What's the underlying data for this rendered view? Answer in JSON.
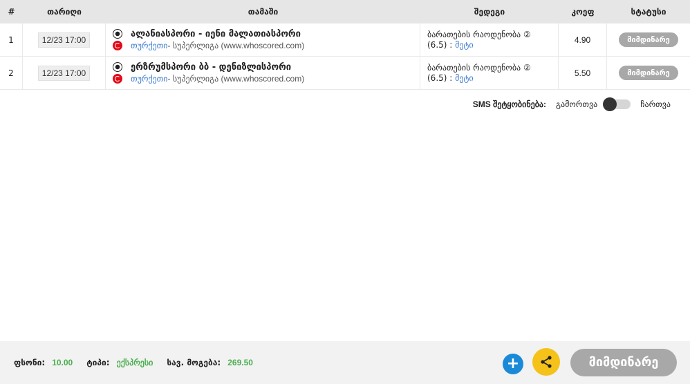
{
  "columns": {
    "idx": "#",
    "date": "თარიღი",
    "game": "თამაში",
    "bet": "შედეგი",
    "odd": "კოეფ",
    "status": "სტატუსი"
  },
  "rows": [
    {
      "idx": "1",
      "date": "12/23 17:00",
      "match": "ალანიასპორი - იენი მალათიასპორი",
      "country": "თურქეთი",
      "league": " - სუპერლიგა (www.whoscored.com)",
      "bet_line1": "ბარათების რაოდენობა ②",
      "bet_line2_prefix": "(6.5) : ",
      "bet_pick": "მეტი",
      "odd": "4.90",
      "status": "მიმდინარე"
    },
    {
      "idx": "2",
      "date": "12/23 17:00",
      "match": "ერზრუმსპორი ბბ - დენიზლისპორი",
      "country": "თურქეთი",
      "league": " - სუპერლიგა (www.whoscored.com)",
      "bet_line1": "ბარათების რაოდენობა ②",
      "bet_line2_prefix": "(6.5) : ",
      "bet_pick": "მეტი",
      "odd": "5.50",
      "status": "მიმდინარე"
    }
  ],
  "sms": {
    "label": "SMS შეტყობინება:",
    "off": "გამორთვა",
    "on": "ჩართვა"
  },
  "footer": {
    "price_label": "ფსონი:",
    "price_value": "10.00",
    "type_label": "ტიპი:",
    "type_value": "ექსპრესი",
    "win_label": "სავ. მოგება:",
    "win_value": "269.50",
    "plus_label": "+",
    "status_label": "მიმდინარე"
  },
  "colors": {
    "accent_green": "#4caf50",
    "link_blue": "#3b7ad1",
    "plus_blue": "#1a8ad8",
    "share_yellow": "#f5c21a",
    "status_gray": "#a8a8a8"
  },
  "icons": {
    "sport": "football-icon",
    "country": "turkey-flag-icon",
    "share": "share-icon",
    "add": "plus-icon"
  }
}
